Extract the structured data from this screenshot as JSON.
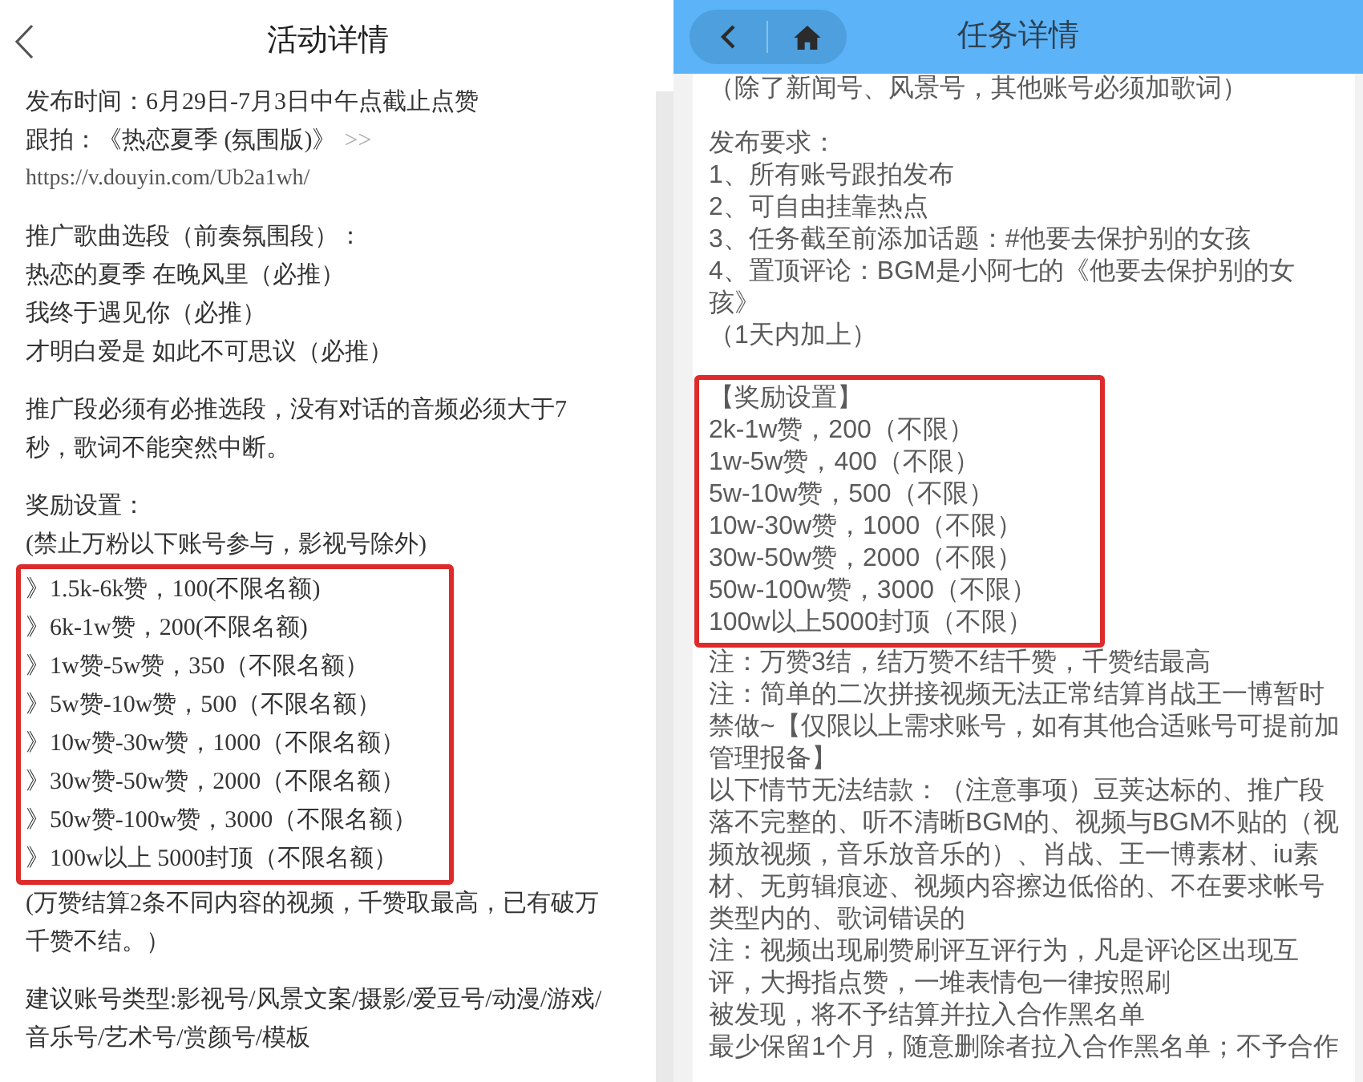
{
  "activity_screen": {
    "title": "活动详情",
    "publish_time": "发布时间：6月29日-7月3日中午点截止点赞",
    "follow": {
      "text": "跟拍：《热恋夏季 (氛围版)》",
      "more": ">>"
    },
    "link": "https://v.douyin.com/Ub2a1wh/",
    "song_section": {
      "heading": "推广歌曲选段（前奏氛围段）：",
      "songs": [
        "热恋的夏季 在晚风里（必推）",
        "我终于遇见你（必推）",
        "才明白爱是 如此不可思议（必推）"
      ]
    },
    "rule": {
      "lines": [
        "推广段必须有必推选段，没有对话的音频必须大于7",
        "秒，歌词不能突然中断。"
      ]
    },
    "rewards": {
      "heading": "奖励设置：",
      "note": "(禁止万粉以下账号参与，影视号除外)",
      "highlighted": true,
      "tiers": [
        "》1.5k-6k赞，100(不限名额)",
        "》6k-1w赞，200(不限名额)",
        "》1w赞-5w赞，350（不限名额）",
        "》5w赞-10w赞，500（不限名额）",
        "》10w赞-30w赞，1000（不限名额）",
        "》30w赞-50w赞，2000（不限名额）",
        "》50w赞-100w赞，3000（不限名额）",
        "》100w以上 5000封顶（不限名额）"
      ]
    },
    "settlement_note": {
      "lines": [
        "(万赞结算2条不同内容的视频，千赞取最高，已有破万",
        "千赞不结。）"
      ]
    },
    "account_types": {
      "lines": [
        "建议账号类型:影视号/风景文案/摄影/爱豆号/动漫/游戏/",
        "音乐号/艺术号/赏颜号/模板"
      ]
    }
  },
  "task_screen": {
    "title": "任务详情",
    "lyrics_note": "（除了新闻号、风景号，其他账号必须加歌词）",
    "requirements": {
      "heading": "发布要求：",
      "items": [
        {
          "lines": [
            "1、所有账号跟拍发布"
          ]
        },
        {
          "lines": [
            "2、可自由挂靠热点"
          ]
        },
        {
          "lines": [
            "3、任务截至前添加话题：#他要去保护别的女孩"
          ]
        },
        {
          "lines": [
            "4、置顶评论：BGM是小阿七的《他要去保护别的女",
            "孩》"
          ]
        }
      ],
      "note": "（1天内加上）"
    },
    "rewards": {
      "heading": "【奖励设置】",
      "highlighted": true,
      "tiers": [
        "2k-1w赞，200（不限）",
        "1w-5w赞，400（不限）",
        "5w-10w赞，500（不限）",
        "10w-30w赞，1000（不限）",
        "30w-50w赞，2000（不限）",
        "50w-100w赞，3000（不限）",
        "100w以上5000封顶（不限）"
      ]
    },
    "notes": [
      {
        "lines": [
          "注：万赞3结，结万赞不结千赞，千赞结最高"
        ]
      },
      {
        "lines": [
          "注：简单的二次拼接视频无法正常结算肖战王一博暂时",
          "禁做~【仅限以上需求账号，如有其他合适账号可提前加",
          "管理报备】"
        ]
      },
      {
        "lines": [
          "以下情节无法结款：（注意事项）豆荚达标的、推广段",
          "落不完整的、听不清晰BGM的、视频与BGM不贴的（视",
          "频放视频，音乐放音乐的）、肖战、王一博素材、iu素",
          "材、无剪辑痕迹、视频内容擦边低俗的、不在要求帐号",
          "类型内的、歌词错误的"
        ]
      },
      {
        "lines": [
          "注：视频出现刷赞刷评互评行为，凡是评论区出现互",
          "评，大拇指点赞，一堆表情包一律按照刷",
          "被发现，将不予结算并拉入合作黑名单",
          "最少保留1个月，随意删除者拉入合作黑名单；不予合作"
        ]
      }
    ]
  }
}
